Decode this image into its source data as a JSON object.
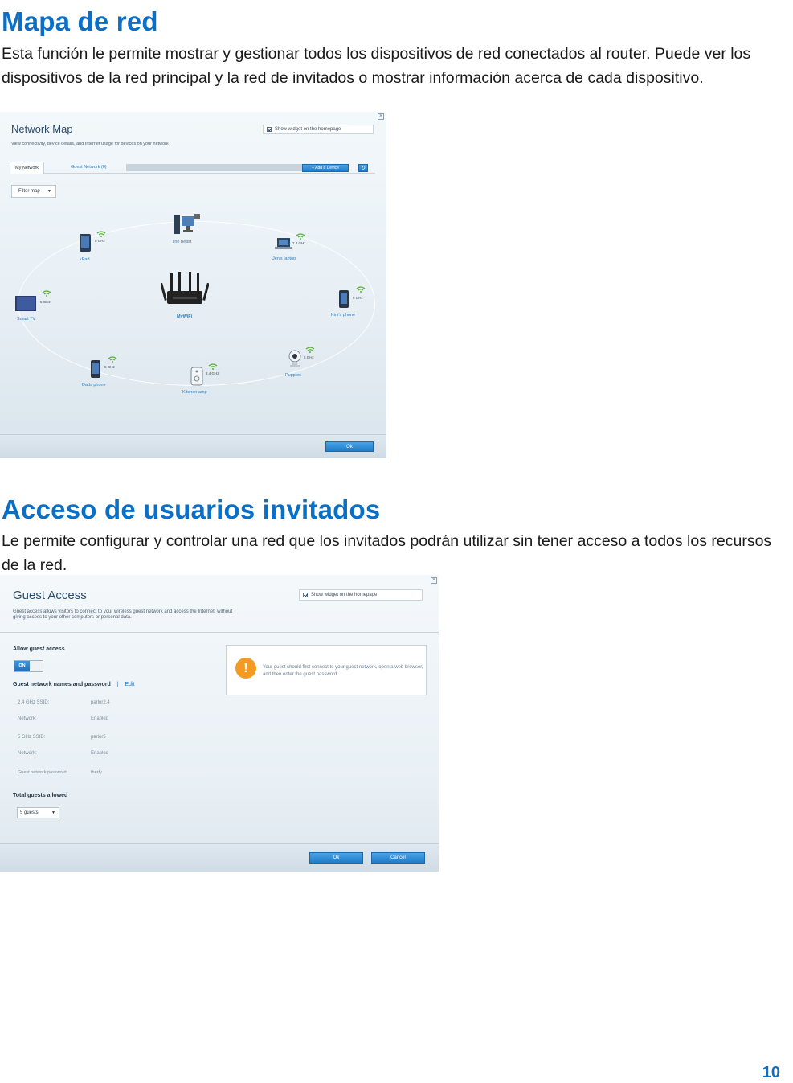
{
  "section1": {
    "heading": "Mapa de red",
    "body": "Esta función le permite mostrar y gestionar todos los dispositivos de red conectados al router. Puede ver los dispositivos de la red principal y la red de invitados o mostrar información acerca de cada dispositivo."
  },
  "network_map": {
    "title": "Network Map",
    "subtitle": "View connectivity, device details, and Internet usage for devices on your network",
    "widget_checkbox": "Show widget on the homepage",
    "tabs": [
      "My Network",
      "Guest Network (0)"
    ],
    "add_device": "+ Add a Device",
    "refresh_icon": "refresh-icon",
    "filter": "Filter map",
    "router": "MyWiFi",
    "devices": [
      {
        "name": "kPad",
        "band": "5 GHz",
        "icon": "tablet-icon"
      },
      {
        "name": "The beast",
        "band": "",
        "icon": "desktop-icon"
      },
      {
        "name": "Jen's laptop",
        "band": "2.4 GHz",
        "icon": "laptop-icon"
      },
      {
        "name": "Smart TV",
        "band": "5 GHz",
        "icon": "tv-icon"
      },
      {
        "name": "Kim's phone",
        "band": "5 GHz",
        "icon": "phone-icon"
      },
      {
        "name": "Dads phone",
        "band": "5 GHz",
        "icon": "phone-icon"
      },
      {
        "name": "Kitchen amp",
        "band": "2.4 GHz",
        "icon": "speaker-icon"
      },
      {
        "name": "Puppies",
        "band": "5 GHz",
        "icon": "camera-icon"
      }
    ],
    "ok": "Ok"
  },
  "section2": {
    "heading": "Acceso de usuarios invitados",
    "body": "Le permite configurar y controlar una red que los invitados podrán utilizar sin tener acceso a todos los recursos de la red."
  },
  "guest_access": {
    "title": "Guest Access",
    "widget_checkbox": "Show widget on the homepage",
    "subtitle_line1": "Guest access allows visitors to connect to your wireless guest network and access the Internet, without",
    "subtitle_line2": "giving access to your other computers or personal data.",
    "allow_label": "Allow guest access",
    "toggle_on": "ON",
    "names_label": "Guest network names and password",
    "separator": "|",
    "edit": "Edit",
    "rows": [
      {
        "key": "2.4 GHz SSID:",
        "value": "parlor2.4"
      },
      {
        "key": "Network:",
        "value": "Enabled"
      },
      {
        "key": "5 GHz SSID:",
        "value": "parlor5"
      },
      {
        "key": "Network:",
        "value": "Enabled"
      },
      {
        "key": "Guest network password:",
        "value": "therfy"
      }
    ],
    "total_label": "Total guests allowed",
    "total_value": "5 guests",
    "notice": "Your guest should first connect to your guest network, open a web browser, and then enter the guest password.",
    "ok": "Ok",
    "cancel": "Cancel"
  },
  "page_number": "10"
}
